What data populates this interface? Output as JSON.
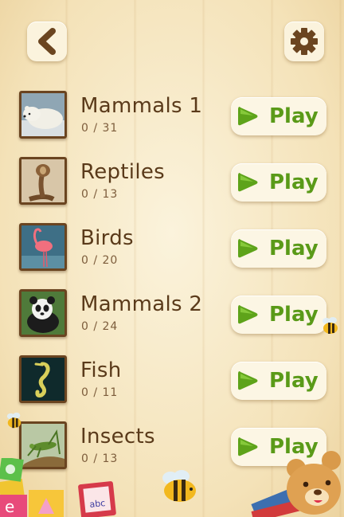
{
  "header": {
    "back_icon": "chevron-left-icon",
    "settings_icon": "gear-icon"
  },
  "categories": [
    {
      "name": "Mammals 1",
      "progress": "0 / 31",
      "play_label": "Play",
      "thumbnail": "polar-bear"
    },
    {
      "name": "Reptiles",
      "progress": "0 / 13",
      "play_label": "Play",
      "thumbnail": "cobra"
    },
    {
      "name": "Birds",
      "progress": "0 / 20",
      "play_label": "Play",
      "thumbnail": "flamingo"
    },
    {
      "name": "Mammals 2",
      "progress": "0 / 24",
      "play_label": "Play",
      "thumbnail": "panda"
    },
    {
      "name": "Fish",
      "progress": "0 / 11",
      "play_label": "Play",
      "thumbnail": "seahorse"
    },
    {
      "name": "Insects",
      "progress": "0 / 13",
      "play_label": "Play",
      "thumbnail": "grasshopper"
    }
  ],
  "decorations": {
    "book_text": "abc"
  },
  "colors": {
    "play_green": "#5a9a18",
    "text_brown": "#5a3a1a",
    "button_cream": "#fcf6e4"
  }
}
